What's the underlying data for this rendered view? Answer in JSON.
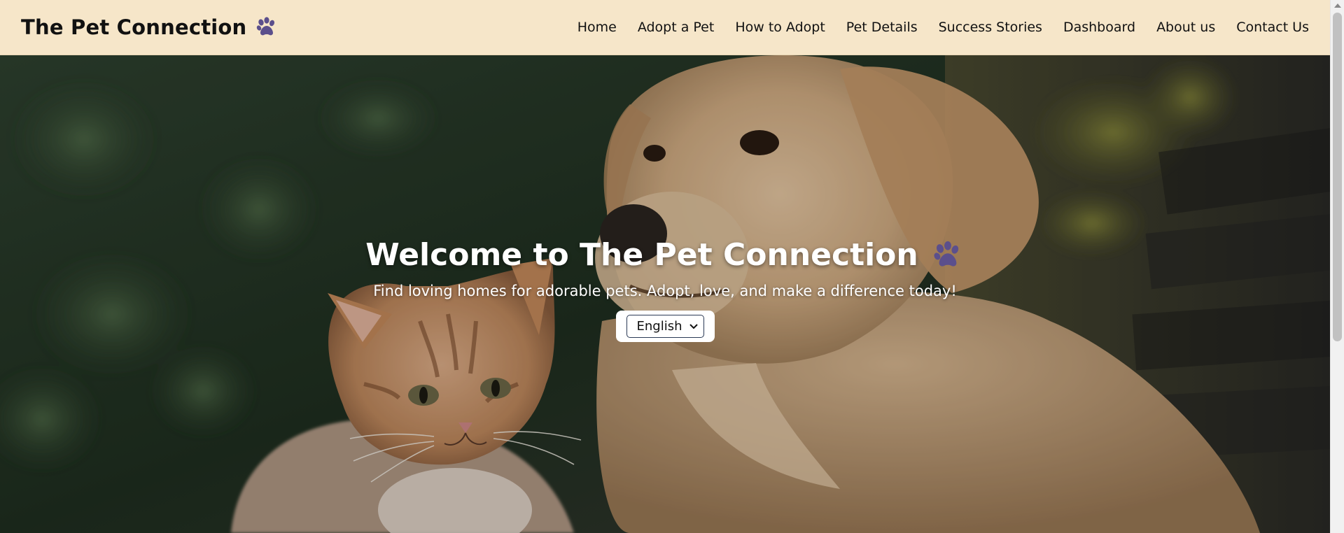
{
  "navbar": {
    "brand": "The Pet Connection",
    "brand_icon": "paw-icon",
    "links": [
      "Home",
      "Adopt a Pet",
      "How to Adopt",
      "Pet Details",
      "Success Stories",
      "Dashboard",
      "About us",
      "Contact Us"
    ]
  },
  "hero": {
    "title": "Welcome to The Pet Connection",
    "title_icon": "paw-icon",
    "subtitle": "Find loving homes for adorable pets. Adopt, love, and make a difference today!",
    "language_select": {
      "selected": "English"
    }
  },
  "colors": {
    "navbar_bg": "#f6e6c9",
    "paw": "#5b4f8c",
    "text_dark": "#111111",
    "hero_text": "#ffffff"
  }
}
